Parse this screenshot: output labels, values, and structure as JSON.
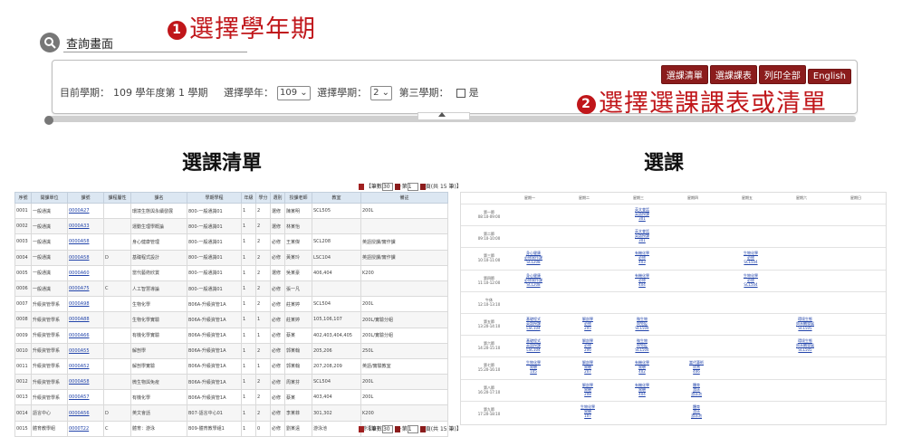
{
  "annotations": {
    "step1": {
      "num": "1",
      "text": "選擇學年期"
    },
    "step2": {
      "num": "2",
      "text": "選擇選課課表或清單"
    }
  },
  "query": {
    "icon": "search-icon",
    "title": "查詢畫面"
  },
  "panel": {
    "current_term_label": "目前學期：",
    "current_term_value": "109 學年度第 1 學期",
    "year_label": "選擇學年：",
    "year_value": "109 ⌄",
    "sem_label": "選擇學期：",
    "sem_value": "2 ⌄",
    "third_label": "第三學期：",
    "third_value": "是",
    "buttons": [
      "選課清單",
      "選課課表",
      "列印全部",
      "English"
    ]
  },
  "left_title": "選課清單",
  "right_title": "選課",
  "pager": {
    "text1": "【筆數",
    "pagesize": "30",
    "text2": "·第",
    "page": "1",
    "text3": "頁(共 15 筆)】"
  },
  "list": {
    "headers": [
      "序號",
      "開課單位",
      "課號",
      "課程屬性",
      "課名",
      "學期學程",
      "年級",
      "學分",
      "選別",
      "授課老師",
      "教室",
      "備註"
    ],
    "rows": [
      [
        "0001",
        "一般通識",
        "0000A27",
        "",
        "環境生態與永續發展",
        "800-一般通識01",
        "1",
        "2",
        "選修",
        "陳某明",
        "SCL505",
        "200L"
      ],
      [
        "0002",
        "一般通識",
        "0000A33",
        "",
        "運動生理學概論",
        "800-一般通識01",
        "1",
        "2",
        "選修",
        "林某怡",
        "",
        ""
      ],
      [
        "0003",
        "一般通識",
        "0000A58",
        "",
        "身心健康管理",
        "800-一般通識01",
        "1",
        "2",
        "必修",
        "王某傑",
        "SCL208",
        "英語授課/實作課"
      ],
      [
        "0004",
        "一般通識",
        "0000A58",
        "D",
        "基礎程式設計",
        "800-一般通識01",
        "1",
        "2",
        "必修",
        "黃某玲",
        "LSC104",
        "英語授課/實作課"
      ],
      [
        "0005",
        "一般通識",
        "0000A60",
        "",
        "當代藝術欣賞",
        "800-一般通識01",
        "1",
        "2",
        "選修",
        "吳某豪",
        "406,404",
        "K200"
      ],
      [
        "0006",
        "一般通識",
        "0000A75",
        "C",
        "人工智慧導論",
        "800-一般通識01",
        "1",
        "2",
        "必修",
        "張一凡",
        "",
        ""
      ],
      [
        "0007",
        "升級資管學系",
        "0000A98",
        "",
        "生物化學",
        "B06A-升級資管1A",
        "1",
        "2",
        "必修",
        "莊某婷",
        "SCL504",
        "200L"
      ],
      [
        "0008",
        "升級資管學系",
        "0000A88",
        "",
        "生物化學實驗",
        "B06A-升級資管1A",
        "1",
        "1",
        "必修",
        "莊某婷",
        "105,106,107",
        "200L/實驗分組"
      ],
      [
        "0009",
        "升級資管學系",
        "0000A66",
        "",
        "有機化學實驗",
        "B06A-升級資管1A",
        "1",
        "1",
        "必修",
        "蔡某",
        "402,403,404,405",
        "200L/實驗分組"
      ],
      [
        "0010",
        "升級資管學系",
        "0000A55",
        "",
        "解剖學",
        "B06A-升級資管1A",
        "1",
        "2",
        "必修",
        "郭某翰",
        "205,206",
        "250L"
      ],
      [
        "0011",
        "升級資管學系",
        "0000A52",
        "",
        "解剖學實驗",
        "B06A-升級資管1A",
        "1",
        "1",
        "必修",
        "郭某翰",
        "207,208,209",
        "英語/實驗教室"
      ],
      [
        "0012",
        "升級資管學系",
        "0000A58",
        "",
        "微生物與免疫",
        "B06A-升級資管1A",
        "1",
        "2",
        "必修",
        "周某芬",
        "SCL504",
        "200L"
      ],
      [
        "0013",
        "升級資管學系",
        "0000A57",
        "",
        "有機化學",
        "B06A-升級資管1A",
        "1",
        "2",
        "必修",
        "蔡某",
        "403,404",
        "200L"
      ],
      [
        "0014",
        "語言中心",
        "0000A56",
        "D",
        "英文會話",
        "B07-語言中心01",
        "1",
        "2",
        "必修",
        "李某菲",
        "301,302",
        "K200"
      ],
      [
        "0015",
        "體育教學組",
        "0000T22",
        "C",
        "體育：游泳",
        "B09-體育教學組1",
        "1",
        "0",
        "必修",
        "劉某遠",
        "游泳池",
        "游泳池"
      ]
    ]
  },
  "timetable": {
    "days": [
      "星期一",
      "星期二",
      "星期三",
      "星期四",
      "星期五",
      "星期六",
      "星期日"
    ],
    "periods": [
      {
        "label": "第一節",
        "time": "08:10-09:00"
      },
      {
        "label": "第二節",
        "time": "09:10-10:00"
      },
      {
        "label": "第三節",
        "time": "10:10-11:00"
      },
      {
        "label": "第四節",
        "time": "11:10-12:00"
      },
      {
        "label": "午休",
        "time": "12:10-13:10"
      },
      {
        "label": "第五節",
        "time": "13:20-14:10"
      },
      {
        "label": "第六節",
        "time": "14:20-15:10"
      },
      {
        "label": "第七節",
        "time": "15:20-16:10"
      },
      {
        "label": "第八節",
        "time": "16:20-17:10"
      },
      {
        "label": "第九節",
        "time": "17:20-18:10"
      }
    ],
    "cells": [
      {
        "row": 0,
        "col": 2,
        "lines": [
          "英文會話",
          "英語授課",
          "301"
        ]
      },
      {
        "row": 1,
        "col": 2,
        "lines": [
          "英文會話",
          "英語授課",
          "301"
        ]
      },
      {
        "row": 2,
        "col": 0,
        "lines": [
          "身心健康",
          "必修實作課",
          "SCL208"
        ]
      },
      {
        "row": 2,
        "col": 2,
        "lines": [
          "有機化學",
          "必修",
          "403"
        ]
      },
      {
        "row": 2,
        "col": 4,
        "lines": [
          "生物化學",
          "必修",
          "SCL504"
        ]
      },
      {
        "row": 3,
        "col": 0,
        "lines": [
          "身心健康",
          "必修實作課",
          "SCL208"
        ]
      },
      {
        "row": 3,
        "col": 2,
        "lines": [
          "有機化學",
          "必修",
          "404"
        ]
      },
      {
        "row": 3,
        "col": 4,
        "lines": [
          "生物化學",
          "必修",
          "SCL504"
        ]
      },
      {
        "row": 5,
        "col": 0,
        "lines": [
          "基礎程式",
          "英語授課",
          "LSC104"
        ]
      },
      {
        "row": 5,
        "col": 1,
        "lines": [
          "解剖學",
          "必修",
          "205"
        ]
      },
      {
        "row": 5,
        "col": 2,
        "lines": [
          "微生物",
          "與免疫",
          "SCL504"
        ]
      },
      {
        "row": 5,
        "col": 5,
        "lines": [
          "環境生態",
          "與永續發展",
          "SCL505"
        ]
      },
      {
        "row": 6,
        "col": 0,
        "lines": [
          "基礎程式",
          "英語授課",
          "LSC104"
        ]
      },
      {
        "row": 6,
        "col": 1,
        "lines": [
          "解剖學",
          "必修",
          "206"
        ]
      },
      {
        "row": 6,
        "col": 2,
        "lines": [
          "微生物",
          "與免疫",
          "SCL504"
        ]
      },
      {
        "row": 6,
        "col": 5,
        "lines": [
          "環境生態",
          "與永續發展",
          "SCL505"
        ]
      },
      {
        "row": 7,
        "col": 0,
        "lines": [
          "生物化學",
          "實驗",
          "105"
        ]
      },
      {
        "row": 7,
        "col": 1,
        "lines": [
          "解剖學",
          "實驗",
          "207"
        ]
      },
      {
        "row": 7,
        "col": 2,
        "lines": [
          "有機化學",
          "實驗",
          "402"
        ]
      },
      {
        "row": 7,
        "col": 3,
        "lines": [
          "當代藝術",
          "欣賞",
          "406"
        ]
      },
      {
        "row": 8,
        "col": 1,
        "lines": [
          "解剖學",
          "實驗",
          "208"
        ]
      },
      {
        "row": 8,
        "col": 2,
        "lines": [
          "有機化學",
          "實驗",
          "404"
        ]
      },
      {
        "row": 8,
        "col": 3,
        "lines": [
          "體育",
          "游泳",
          "游泳池"
        ]
      },
      {
        "row": 9,
        "col": 1,
        "lines": [
          "生物化學",
          "實驗",
          "107"
        ]
      },
      {
        "row": 9,
        "col": 3,
        "lines": [
          "體育",
          "游泳",
          "游泳池"
        ]
      }
    ]
  }
}
